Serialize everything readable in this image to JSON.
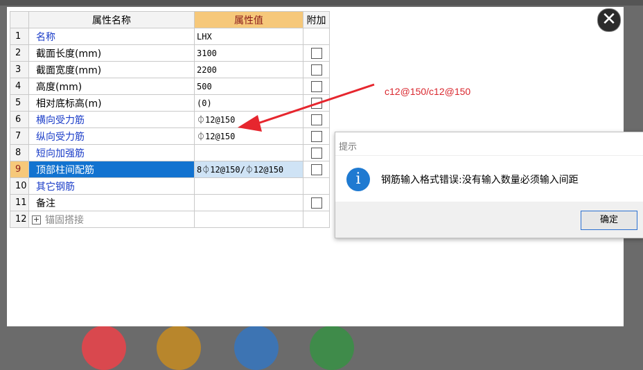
{
  "grid": {
    "headers": {
      "name": "属性名称",
      "value": "属性值",
      "extra": "附加"
    },
    "rows": [
      {
        "num": "1",
        "name": "名称",
        "value": "LHX"
      },
      {
        "num": "2",
        "name": "截面长度(mm)",
        "value": "3100"
      },
      {
        "num": "3",
        "name": "截面宽度(mm)",
        "value": "2200"
      },
      {
        "num": "4",
        "name": "高度(mm)",
        "value": "500"
      },
      {
        "num": "5",
        "name": "相对底标高(m)",
        "value": "(0)"
      },
      {
        "num": "6",
        "name": "横向受力筋",
        "value": "⏀12@150"
      },
      {
        "num": "7",
        "name": "纵向受力筋",
        "value": "⏀12@150"
      },
      {
        "num": "8",
        "name": "短向加强筋",
        "value": ""
      },
      {
        "num": "9",
        "name": "顶部柱间配筋",
        "value": "8⏀12@150/⏀12@150"
      },
      {
        "num": "10",
        "name": "其它钢筋",
        "value": ""
      },
      {
        "num": "11",
        "name": "备注",
        "value": ""
      },
      {
        "num": "12",
        "name": "锚固搭接",
        "value": ""
      }
    ]
  },
  "annotation": {
    "text": "c12@150/c12@150",
    "color": "#d9272e"
  },
  "dialog": {
    "title": "提示",
    "message": "钢筋输入格式错误:没有输入数量必须输入间距",
    "ok_label": "确定",
    "icon": "info-icon"
  },
  "close_icon": "close-icon",
  "colors": {
    "header_accent": "#f6c87a",
    "selected_row": "#1273d0",
    "link_text": "#1a3cc8"
  }
}
